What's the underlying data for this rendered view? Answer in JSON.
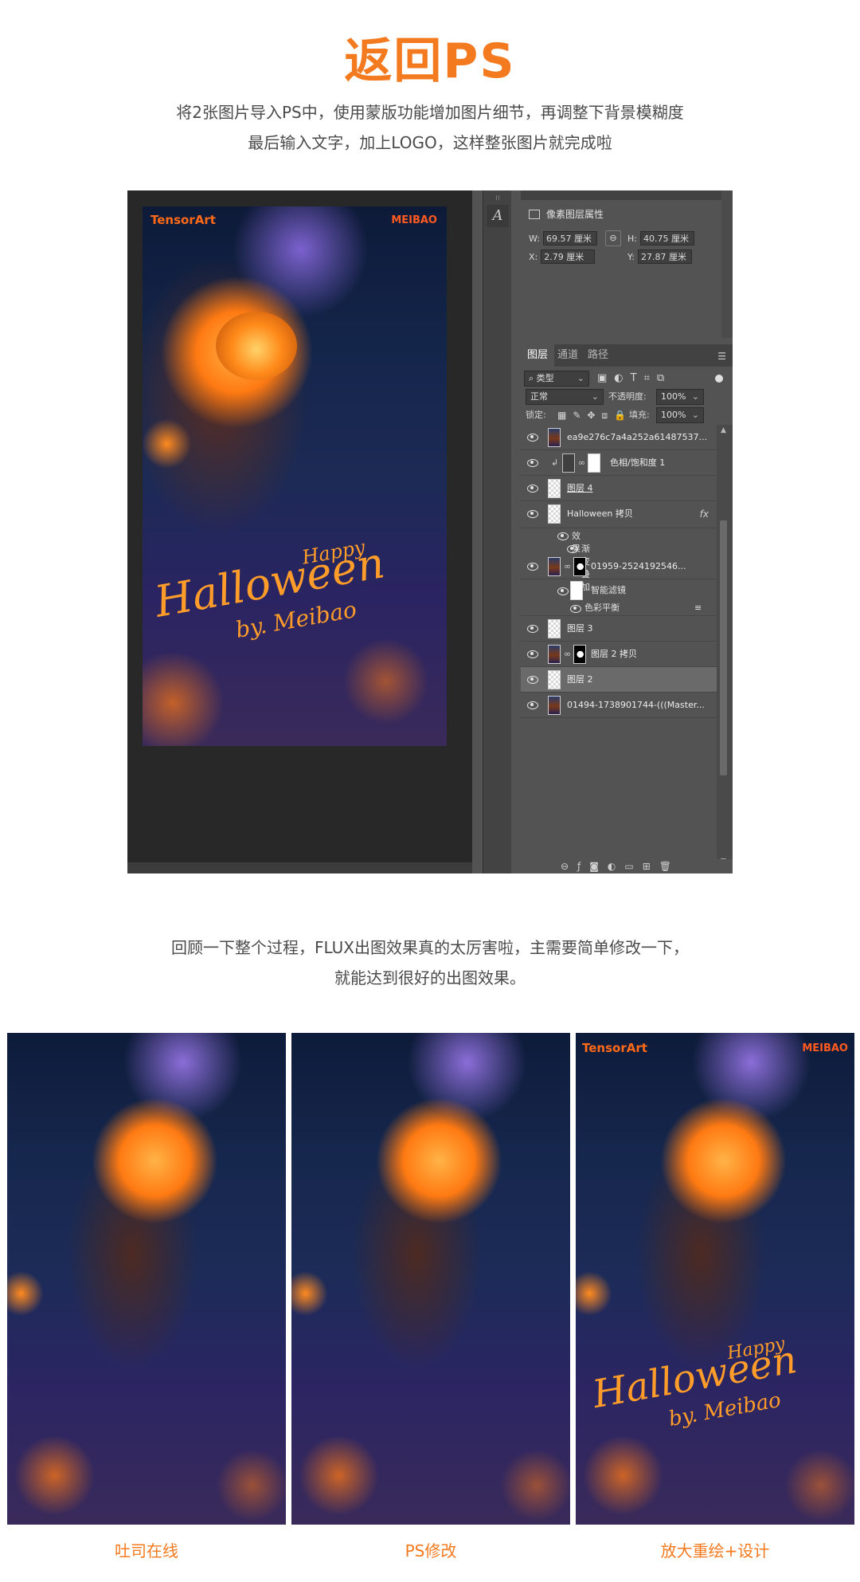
{
  "title": "返回PS",
  "intro": {
    "line1": "将2张图片导入PS中，使用蒙版功能增加图片细节，再调整下背景模糊度",
    "line2": "最后输入文字，加上LOGO，这样整张图片就完成啦"
  },
  "artwork": {
    "logo_left": "TensorArt",
    "logo_right": "MEIBAO",
    "text_happy": "Happy",
    "text_halloween": "Halloween",
    "text_by": "by. Meibao"
  },
  "properties": {
    "title": "像素图层属性",
    "w_label": "W:",
    "w_value": "69.57 厘米",
    "h_label": "H:",
    "h_value": "40.75 厘米",
    "x_label": "X:",
    "x_value": "2.79 厘米",
    "y_label": "Y:",
    "y_value": "27.87 厘米"
  },
  "layers_panel": {
    "tabs": [
      "图层",
      "通道",
      "路径"
    ],
    "filter_label": "类型",
    "blend_mode": "正常",
    "opacity_label": "不透明度:",
    "opacity_value": "100%",
    "lock_label": "锁定:",
    "fill_label": "填充:",
    "fill_value": "100%",
    "layers": [
      {
        "name": "ea9e276c7a4a252a61487537...",
        "thumb": "img"
      },
      {
        "name": "色相/饱和度 1",
        "thumb": "adj"
      },
      {
        "name": "图层 4",
        "thumb": "transparent"
      },
      {
        "name": "Halloween 拷贝",
        "thumb": "transparent",
        "fx": "fx"
      },
      {
        "name": "01959-2524192546...",
        "thumb": "img"
      },
      {
        "name": "图层 3",
        "thumb": "transparent"
      },
      {
        "name": "图层 2 拷贝",
        "thumb": "img"
      },
      {
        "name": "图层 2",
        "thumb": "transparent",
        "selected": true
      },
      {
        "name": "01494-1738901744-(((Master...",
        "thumb": "img"
      }
    ],
    "effects_label": "效果",
    "gradient_overlay_label": "渐变叠加",
    "smart_filter_label": "智能滤镜",
    "color_balance_label": "色彩平衡"
  },
  "outro": {
    "line1": "回顾一下整个过程，FLUX出图效果真的太厉害啦，主需要简单修改一下，",
    "line2": "就能达到很好的出图效果。"
  },
  "comparison": {
    "captions": [
      "吐司在线",
      "PS修改",
      "放大重绘+设计"
    ]
  },
  "colors": {
    "accent": "#f47a1f",
    "ps_panel": "#535353",
    "ps_canvas": "#282828"
  }
}
